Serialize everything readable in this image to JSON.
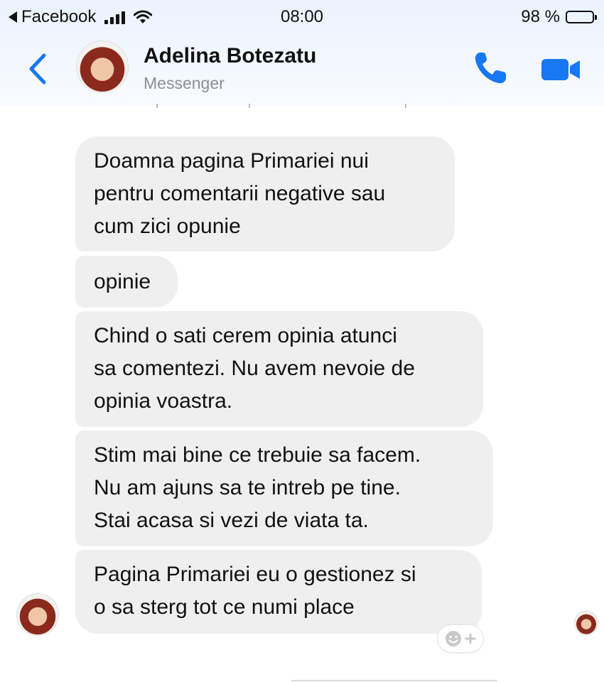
{
  "status_bar": {
    "back_app": "Facebook",
    "time": "08:00",
    "battery": "98 %",
    "battery_level": 0.98
  },
  "header": {
    "contact_name": "Adelina Botezatu",
    "subtitle": "Messenger",
    "icons": [
      "back-chevron-icon",
      "phone-icon",
      "video-camera-icon"
    ],
    "accent_color": "#1877f2"
  },
  "messages": [
    {
      "text": "Doamna pagina Primariei nui\npentru comentarii negative sau\ncum zici opunie"
    },
    {
      "text": "opinie"
    },
    {
      "text": "Chind o sati cerem opinia atunci\nsa comentezi. Nu avem nevoie de\nopinia voastra."
    },
    {
      "text": "Stim mai bine ce trebuie sa facem.\nNu am ajuns sa te intreb pe tine.\nStai acasa si vezi de viata ta."
    },
    {
      "text": "Pagina Primariei eu o gestionez si\no sa sterg tot ce numi place"
    }
  ],
  "bubble_color": "#efefef"
}
